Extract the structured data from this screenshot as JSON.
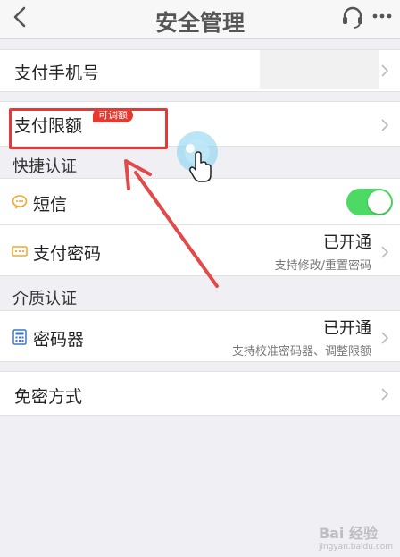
{
  "header": {
    "title": "安全管理",
    "back_icon": "back-arrow-icon",
    "support_icon": "headset-icon",
    "more_icon": "more-dots-icon"
  },
  "rows": {
    "pay_phone": {
      "label": "支付手机号"
    },
    "pay_limit": {
      "label": "支付限额",
      "badge": "可调额"
    },
    "sms": {
      "label": "短信",
      "toggle_on": true
    },
    "pay_password": {
      "label": "支付密码",
      "status": "已开通",
      "sub": "支持修改/重置密码"
    },
    "token": {
      "label": "密码器",
      "status": "已开通",
      "sub": "支持校准密码器、调整限额"
    },
    "no_pin": {
      "label": "免密方式"
    }
  },
  "sections": {
    "quick_auth": "快捷认证",
    "medium_auth": "介质认证"
  },
  "watermark": {
    "brand": "Bai 经验",
    "url": "jingyan.baidu.com"
  },
  "colors": {
    "toggle_on": "#4cd964",
    "highlight": "#e23a3a",
    "badge": "#e8382e"
  }
}
